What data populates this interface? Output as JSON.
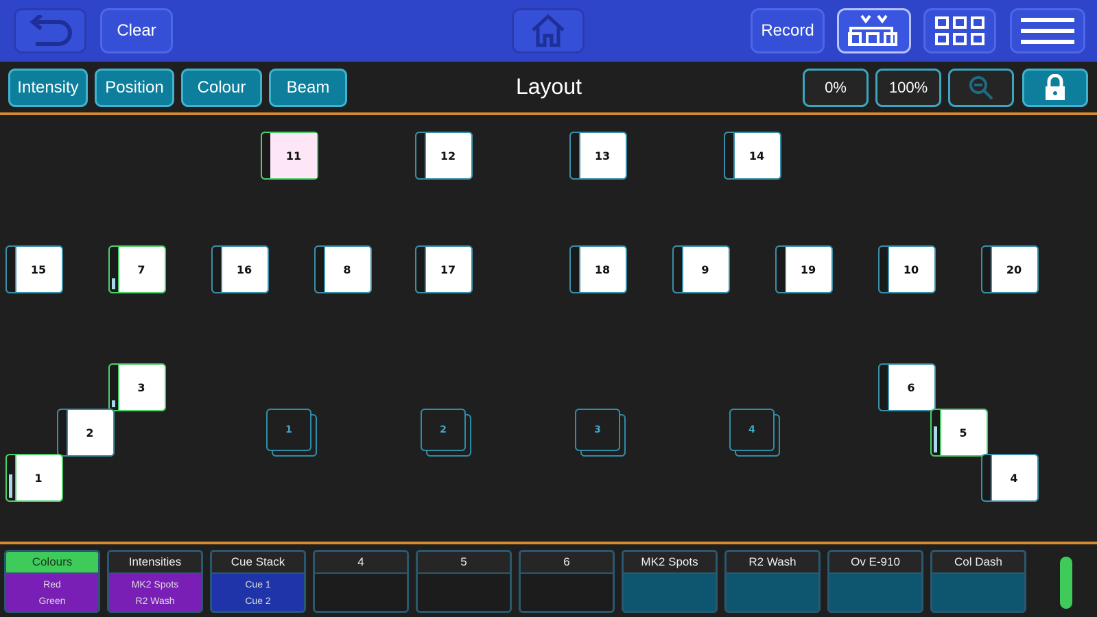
{
  "topbar": {
    "clear_label": "Clear",
    "record_label": "Record",
    "icons": [
      "back-arrow-icon",
      "home-icon",
      "fader-bank-icon",
      "grid-icon",
      "menu-icon"
    ]
  },
  "attributes": [
    "Intensity",
    "Position",
    "Colour",
    "Beam"
  ],
  "page_title": "Layout",
  "levels": {
    "zero": "0%",
    "full": "100%"
  },
  "fixtures": [
    {
      "label": "11",
      "tint": "#fde7f7",
      "selected": true
    },
    {
      "label": "12"
    },
    {
      "label": "13"
    },
    {
      "label": "14"
    },
    {
      "label": "15"
    },
    {
      "label": "7",
      "selected": true,
      "level": 0.25
    },
    {
      "label": "16"
    },
    {
      "label": "8"
    },
    {
      "label": "17"
    },
    {
      "label": "18"
    },
    {
      "label": "9"
    },
    {
      "label": "19"
    },
    {
      "label": "10"
    },
    {
      "label": "20"
    },
    {
      "label": "3",
      "selected": true,
      "level": 0.15
    },
    {
      "label": "2"
    },
    {
      "label": "1",
      "selected": true,
      "level": 0.5
    },
    {
      "label": "6"
    },
    {
      "label": "5",
      "selected": true,
      "level": 0.6
    },
    {
      "label": "4"
    }
  ],
  "groups": [
    "1",
    "2",
    "3",
    "4"
  ],
  "playbacks": [
    {
      "title": "Colours",
      "lines": [
        "Red",
        "Green"
      ]
    },
    {
      "title": "Intensities",
      "lines": [
        "MK2 Spots",
        "R2 Wash"
      ]
    },
    {
      "title": "Cue Stack",
      "lines": [
        "Cue 1",
        "Cue 2"
      ]
    },
    {
      "title": "4",
      "lines": []
    },
    {
      "title": "5",
      "lines": []
    },
    {
      "title": "6",
      "lines": []
    },
    {
      "title": "MK2 Spots",
      "lines": []
    },
    {
      "title": "R2 Wash",
      "lines": []
    },
    {
      "title": "Ov E-910",
      "lines": []
    },
    {
      "title": "Col Dash",
      "lines": []
    }
  ],
  "colors": {
    "topbar": "#2f45c9",
    "accent_orange": "#d88a2e",
    "attribute_button": "#0d7e9c",
    "selected_green": "#4cd06a",
    "playback_purple": "#7a1fb5",
    "playback_navy": "#1f34a8",
    "playback_teal": "#0e5570"
  }
}
